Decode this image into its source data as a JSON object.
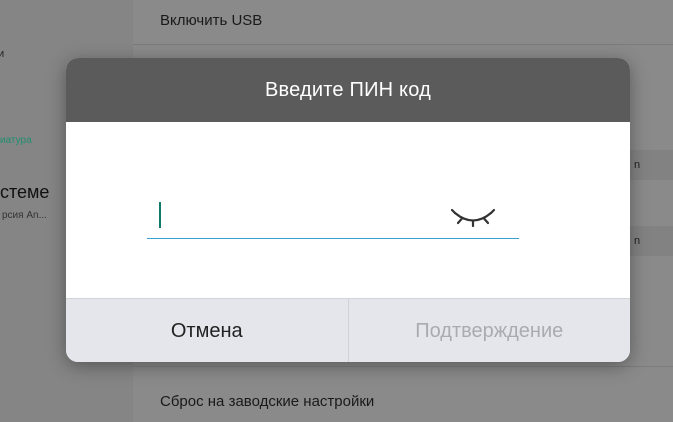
{
  "background": {
    "sidebar": {
      "item_partial_top": "и",
      "item_keyboard": "иатура",
      "item_system_title": "стеме",
      "item_system_subtitle": "рсия An..."
    },
    "settings": {
      "enable_usb": "Включить USB",
      "factory_reset": "Сброс на заводские настройки",
      "chip_1": "n",
      "chip_2": "n"
    }
  },
  "dialog": {
    "title": "Введите ПИН код",
    "pin_value": "",
    "cancel_label": "Отмена",
    "confirm_label": "Подтверждение"
  },
  "colors": {
    "header_bg": "#5b5b5b",
    "input_underline": "#3aa0cc",
    "caret": "#0f7a6a",
    "accent_green": "#1f8f6e",
    "confirm_disabled_text": "#a9abb0"
  },
  "icons": {
    "password_visibility": "eye-closed-icon"
  }
}
